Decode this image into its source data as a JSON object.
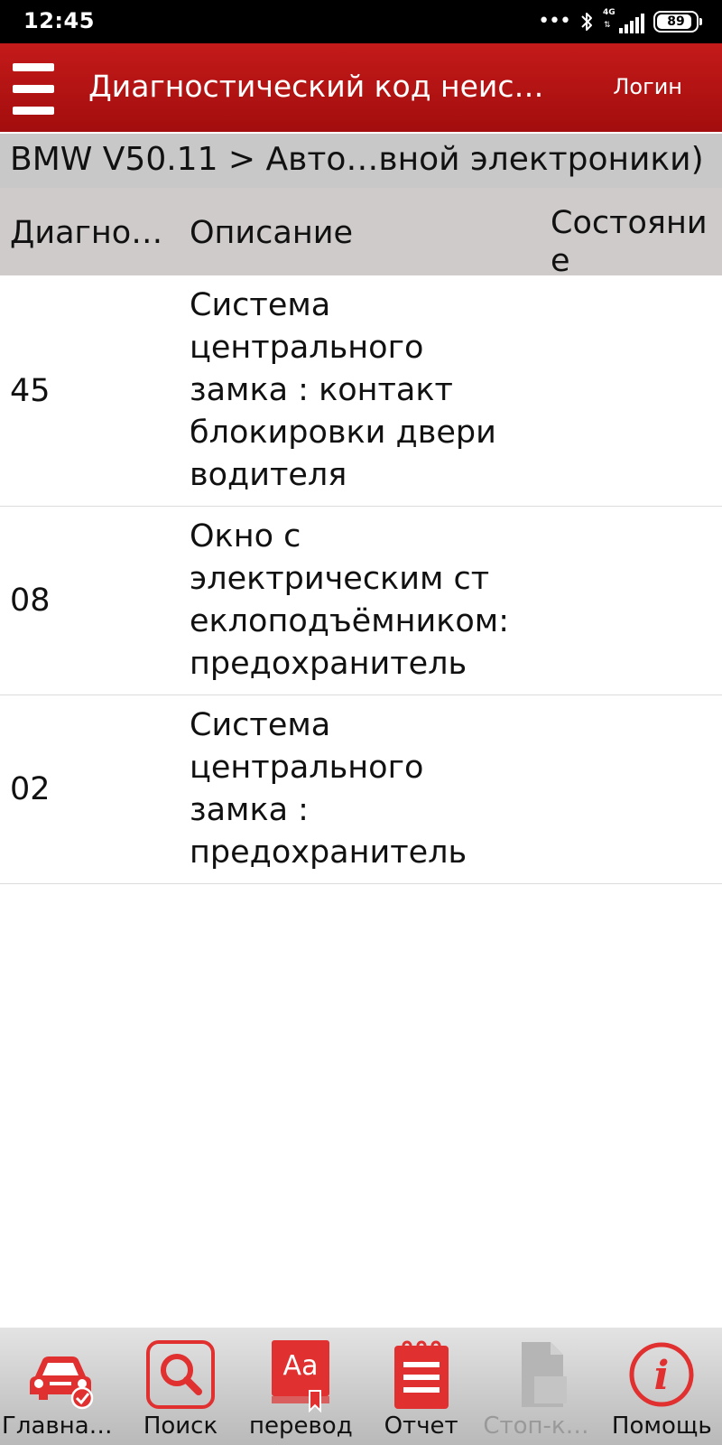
{
  "status_bar": {
    "time": "12:45",
    "network_type": "4G",
    "battery": "89",
    "dots": "•••"
  },
  "app_bar": {
    "title": "Диагностический код неисправности",
    "login_label": "Логин"
  },
  "breadcrumb": "BMW V50.11 > Авто…вной электроники)",
  "table": {
    "columns": [
      "Диагно…",
      "Описание",
      "Состояние"
    ],
    "rows": [
      {
        "code": "45",
        "description": "Система\nцентрального\nзамка :  контакт\nблокировки двери\nводителя",
        "state": ""
      },
      {
        "code": "08",
        "description": "Окно с\nэлектрическим ст\nеклоподъёмником:\nпредохранитель",
        "state": ""
      },
      {
        "code": "02",
        "description": "Система\nцентрального\nзамка :\nпредохранитель",
        "state": ""
      }
    ]
  },
  "bottom_nav": [
    {
      "label": "Главная...",
      "icon": "car-check-icon",
      "enabled": true
    },
    {
      "label": "Поиск",
      "icon": "search-icon",
      "enabled": true
    },
    {
      "label": "перевод",
      "icon": "translate-book-icon",
      "icon_text": "Aa",
      "enabled": true
    },
    {
      "label": "Отчет",
      "icon": "report-notepad-icon",
      "enabled": true
    },
    {
      "label": "Стоп-ка...",
      "icon": "freeze-frame-document-icon",
      "enabled": false
    },
    {
      "label": "Помощь",
      "icon": "help-info-icon",
      "icon_text": "i",
      "enabled": true
    }
  ],
  "colors": {
    "accent": "#c41a1a",
    "icon_red": "#e03030",
    "header_gray": "#d0cbcb",
    "breadcrumb_gray": "#c8c8c8",
    "disabled": "#b5b5b5"
  }
}
